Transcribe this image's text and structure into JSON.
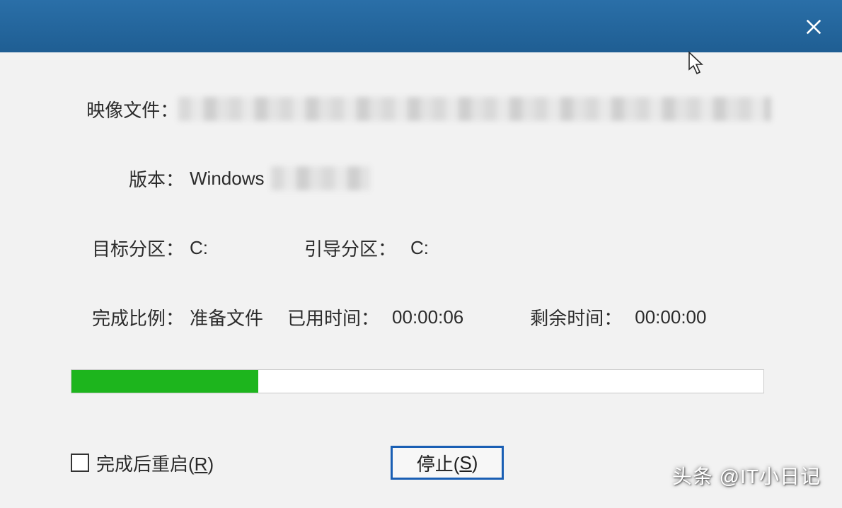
{
  "titlebar": {
    "title": ""
  },
  "fields": {
    "image_file_label": "映像文件：",
    "version_label": "版本：",
    "version_value": "Windows",
    "target_partition_label": "目标分区：",
    "target_partition_value": "C:",
    "boot_partition_label": "引导分区：",
    "boot_partition_value": "C:",
    "completion_ratio_label": "完成比例：",
    "completion_ratio_value": "准备文件",
    "elapsed_time_label": "已用时间：",
    "elapsed_time_value": "00:00:06",
    "remaining_time_label": "剩余时间：",
    "remaining_time_value": "00:00:00"
  },
  "progress": {
    "percent": 27
  },
  "footer": {
    "restart_checkbox_label_pre": "完成后重启(",
    "restart_checkbox_key": "R",
    "restart_checkbox_label_post": ")",
    "restart_checked": false,
    "stop_button_label_pre": "停止(",
    "stop_button_key": "S",
    "stop_button_label_post": ")"
  },
  "watermark": "头条 @IT小日记"
}
